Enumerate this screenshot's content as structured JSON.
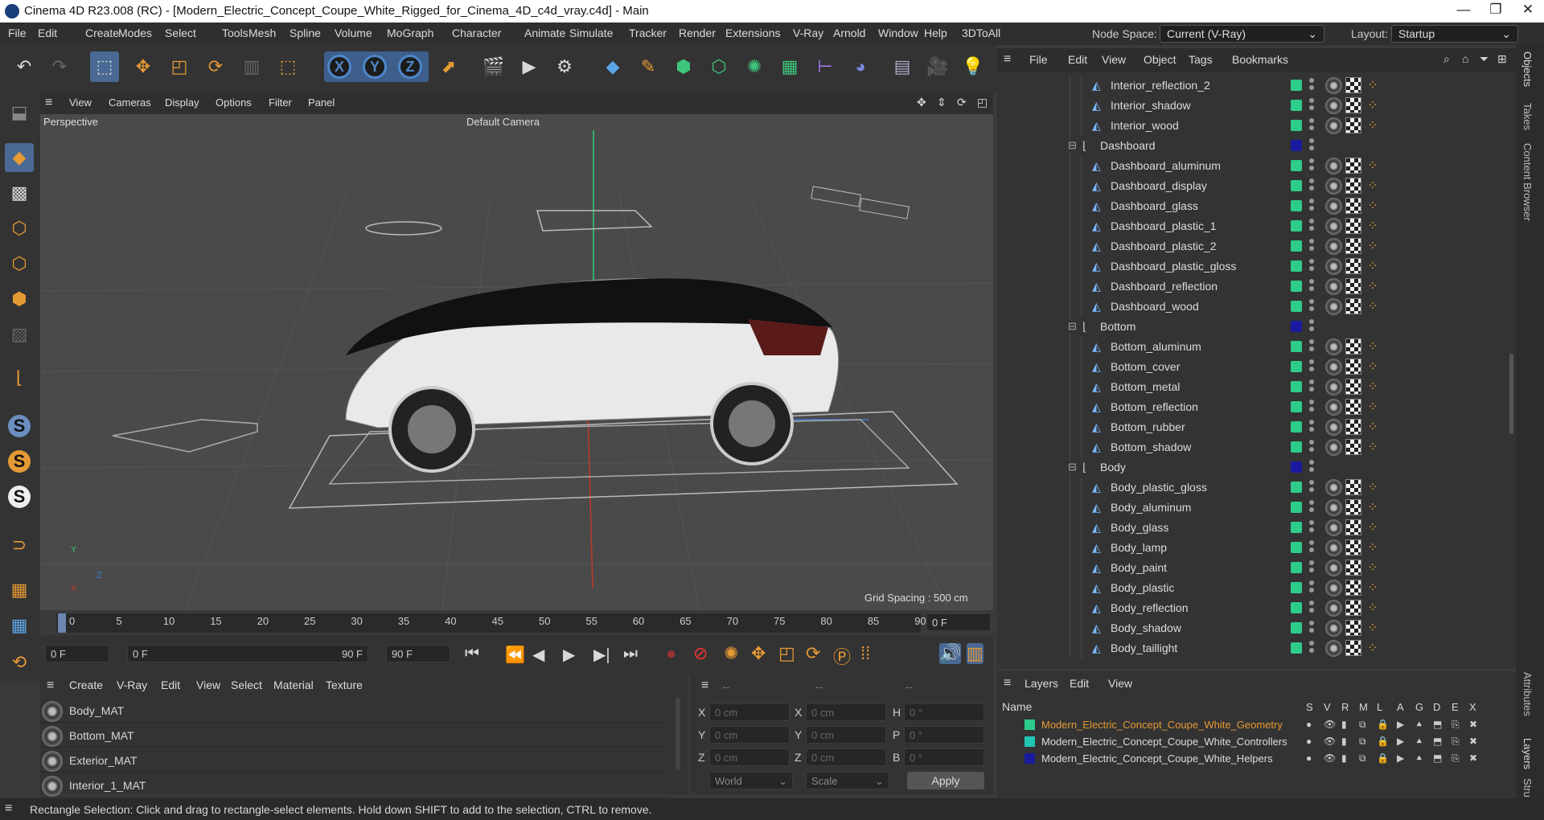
{
  "window": {
    "title": "Cinema 4D R23.008 (RC) - [Modern_Electric_Concept_Coupe_White_Rigged_for_Cinema_4D_c4d_vray.c4d] - Main"
  },
  "menubar": {
    "items": [
      "File",
      "Edit",
      "Create",
      "Modes",
      "Select",
      "Tools",
      "Mesh",
      "Spline",
      "Volume",
      "MoGraph",
      "Character",
      "Animate",
      "Simulate",
      "Tracker",
      "Render",
      "Extensions",
      "V-Ray",
      "Arnold",
      "Window",
      "Help",
      "3DToAll"
    ],
    "node_space_label": "Node Space:",
    "node_space_value": "Current (V-Ray)",
    "layout_label": "Layout:",
    "layout_value": "Startup"
  },
  "viewport": {
    "menu": [
      "View",
      "Cameras",
      "Display",
      "Options",
      "Filter",
      "Panel"
    ],
    "view_name": "Perspective",
    "camera": "Default Camera",
    "grid_spacing": "Grid Spacing : 500 cm",
    "axis_y": "Y",
    "axis_z": "Z",
    "axis_x": "X"
  },
  "timeline": {
    "ticks": [
      "0",
      "5",
      "10",
      "15",
      "20",
      "25",
      "30",
      "35",
      "40",
      "45",
      "50",
      "55",
      "60",
      "65",
      "70",
      "75",
      "80",
      "85",
      "90"
    ],
    "current_frame": "0 F"
  },
  "playbar": {
    "start": "0 F",
    "range_start": "0 F",
    "range_end": "90 F",
    "end": "90 F"
  },
  "material_manager": {
    "menu": [
      "Create",
      "V-Ray",
      "Edit",
      "View",
      "Select",
      "Material",
      "Texture"
    ],
    "materials": [
      "Body_MAT",
      "Bottom_MAT",
      "Exterior_MAT",
      "Interior_1_MAT"
    ]
  },
  "attributes": {
    "header": [
      "--",
      "--",
      "--"
    ],
    "x_label": "X",
    "y_label": "Y",
    "z_label": "Z",
    "h_label": "H",
    "p_label": "P",
    "b_label": "B",
    "pos_x": "0 cm",
    "pos_y": "0 cm",
    "pos_z": "0 cm",
    "size_x": "0 cm",
    "size_y": "0 cm",
    "size_z": "0 cm",
    "rot_h": "0 °",
    "rot_p": "0 °",
    "rot_b": "0 °",
    "coord_mode": "World",
    "scale_mode": "Scale",
    "apply": "Apply"
  },
  "object_manager": {
    "menu": [
      "File",
      "Edit",
      "View",
      "Object",
      "Tags",
      "Bookmarks"
    ],
    "rows": [
      {
        "name": "Interior_reflection_2",
        "type": "obj"
      },
      {
        "name": "Interior_shadow",
        "type": "obj"
      },
      {
        "name": "Interior_wood",
        "type": "obj"
      },
      {
        "name": "Dashboard",
        "type": "group"
      },
      {
        "name": "Dashboard_aluminum",
        "type": "obj"
      },
      {
        "name": "Dashboard_display",
        "type": "obj"
      },
      {
        "name": "Dashboard_glass",
        "type": "obj"
      },
      {
        "name": "Dashboard_plastic_1",
        "type": "obj"
      },
      {
        "name": "Dashboard_plastic_2",
        "type": "obj"
      },
      {
        "name": "Dashboard_plastic_gloss",
        "type": "obj"
      },
      {
        "name": "Dashboard_reflection",
        "type": "obj"
      },
      {
        "name": "Dashboard_wood",
        "type": "obj"
      },
      {
        "name": "Bottom",
        "type": "group"
      },
      {
        "name": "Bottom_aluminum",
        "type": "obj"
      },
      {
        "name": "Bottom_cover",
        "type": "obj"
      },
      {
        "name": "Bottom_metal",
        "type": "obj"
      },
      {
        "name": "Bottom_reflection",
        "type": "obj"
      },
      {
        "name": "Bottom_rubber",
        "type": "obj"
      },
      {
        "name": "Bottom_shadow",
        "type": "obj"
      },
      {
        "name": "Body",
        "type": "group"
      },
      {
        "name": "Body_plastic_gloss",
        "type": "obj"
      },
      {
        "name": "Body_aluminum",
        "type": "obj"
      },
      {
        "name": "Body_glass",
        "type": "obj"
      },
      {
        "name": "Body_lamp",
        "type": "obj"
      },
      {
        "name": "Body_paint",
        "type": "obj"
      },
      {
        "name": "Body_plastic",
        "type": "obj"
      },
      {
        "name": "Body_reflection",
        "type": "obj"
      },
      {
        "name": "Body_shadow",
        "type": "obj"
      },
      {
        "name": "Body_taillight",
        "type": "obj"
      }
    ]
  },
  "layers": {
    "menu": [
      "Layers",
      "Edit",
      "View"
    ],
    "name_header": "Name",
    "col_headers": [
      "S",
      "V",
      "R",
      "M",
      "L",
      "A",
      "G",
      "D",
      "E",
      "X"
    ],
    "items": [
      {
        "name": "Modern_Electric_Concept_Coupe_White_Geometry",
        "color": "#2ecc8a",
        "highlight": true
      },
      {
        "name": "Modern_Electric_Concept_Coupe_White_Controllers",
        "color": "#22c4b4",
        "highlight": false
      },
      {
        "name": "Modern_Electric_Concept_Coupe_White_Helpers",
        "color": "#1a1aa0",
        "highlight": false
      }
    ]
  },
  "right_tabs": [
    "Objects",
    "Takes",
    "Content Browser",
    "Attributes",
    "Layers",
    "Stru"
  ],
  "status": {
    "text": "Rectangle Selection: Click and drag to rectangle-select elements. Hold down SHIFT to add to the selection, CTRL to remove."
  },
  "colors": {
    "accent": "#4a6a95",
    "green": "#2ecc8a",
    "blue": "#1a1aa0",
    "orange": "#e69a35"
  }
}
